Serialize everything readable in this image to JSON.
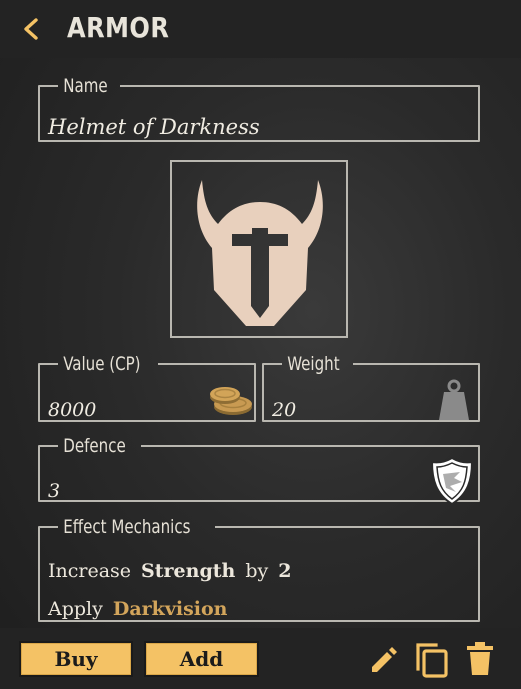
{
  "header": {
    "title": "ARMOR"
  },
  "name_field": {
    "label": "Name",
    "value": "Helmet of Darkness"
  },
  "image": {
    "icon": "horned-helmet-icon"
  },
  "value_field": {
    "label": "Value (CP)",
    "value": "8000",
    "icon": "coins-icon"
  },
  "weight_field": {
    "label": "Weight",
    "value": "20",
    "icon": "weight-icon"
  },
  "defence_field": {
    "label": "Defence",
    "value": "3",
    "icon": "shield-icon"
  },
  "effect_mechanics": {
    "label": "Effect Mechanics",
    "rows": [
      {
        "verb": "Increase",
        "stat": "Strength",
        "by": "by",
        "amount": "2"
      },
      {
        "verb": "Apply",
        "effect": "Darkvision"
      }
    ]
  },
  "footer": {
    "buy_label": "Buy",
    "add_label": "Add",
    "icons": [
      "edit-icon",
      "copy-icon",
      "delete-icon"
    ]
  },
  "colors": {
    "accent": "#f4c265",
    "gold_text": "#d3a55b",
    "bar": "#232323",
    "border": "#b9b7b0",
    "helmet": "#e8d0bd"
  }
}
